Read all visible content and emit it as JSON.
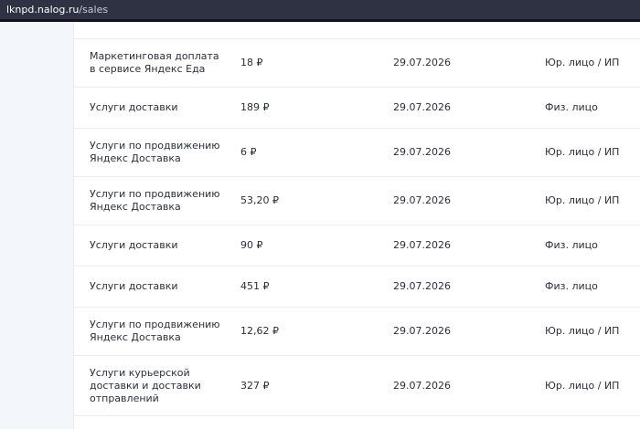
{
  "address_bar": {
    "host": "lknpd.nalog.ru",
    "path": "/sales"
  },
  "sales": [
    {
      "name": "Маркетинговая доплата в сервисе Яндекс Еда",
      "amount": "18 ₽",
      "date": "29.07.2026",
      "payer": "Юр. лицо / ИП"
    },
    {
      "name": "Услуги доставки",
      "amount": "189 ₽",
      "date": "29.07.2026",
      "payer": "Физ. лицо"
    },
    {
      "name": "Услуги по продвижению Яндекс Доставка",
      "amount": "6 ₽",
      "date": "29.07.2026",
      "payer": "Юр. лицо / ИП"
    },
    {
      "name": "Услуги по продвижению Яндекс Доставка",
      "amount": "53,20 ₽",
      "date": "29.07.2026",
      "payer": "Юр. лицо / ИП"
    },
    {
      "name": "Услуги доставки",
      "amount": "90 ₽",
      "date": "29.07.2026",
      "payer": "Физ. лицо"
    },
    {
      "name": "Услуги доставки",
      "amount": "451 ₽",
      "date": "29.07.2026",
      "payer": "Физ. лицо"
    },
    {
      "name": "Услуги по продвижению Яндекс Доставка",
      "amount": "12,62 ₽",
      "date": "29.07.2026",
      "payer": "Юр. лицо / ИП"
    },
    {
      "name": "Услуги курьерской доставки и доставки отправлений",
      "amount": "327 ₽",
      "date": "29.07.2026",
      "payer": "Юр. лицо / ИП"
    }
  ]
}
